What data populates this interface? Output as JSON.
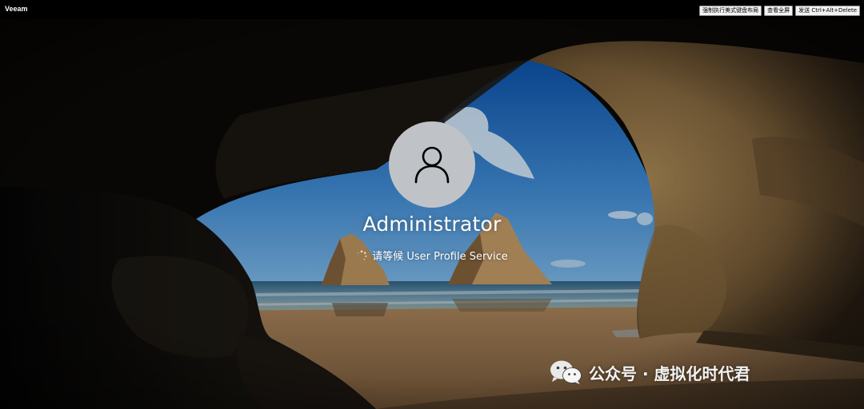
{
  "app": {
    "title": "Veeam"
  },
  "toolbar": {
    "buttons": [
      {
        "label": "强制执行美式键盘布局"
      },
      {
        "label": "查看全屏"
      },
      {
        "label": "发送 Ctrl+Alt+Delete"
      }
    ]
  },
  "lockscreen": {
    "username": "Administrator",
    "status_text": "请等候 User Profile Service",
    "avatar_icon": "user-icon",
    "spinner_icon": "loading-spinner-icon"
  },
  "watermark": {
    "text": "公众号 · 虚拟化时代君",
    "icon": "wechat-icon"
  },
  "colors": {
    "avatar_bg": "#bfc3c8",
    "sky": "#3d7fc4",
    "rock": "#8a6a3e",
    "sand": "#a7815a",
    "toolbar_button_bg": "#f2f2f2"
  }
}
